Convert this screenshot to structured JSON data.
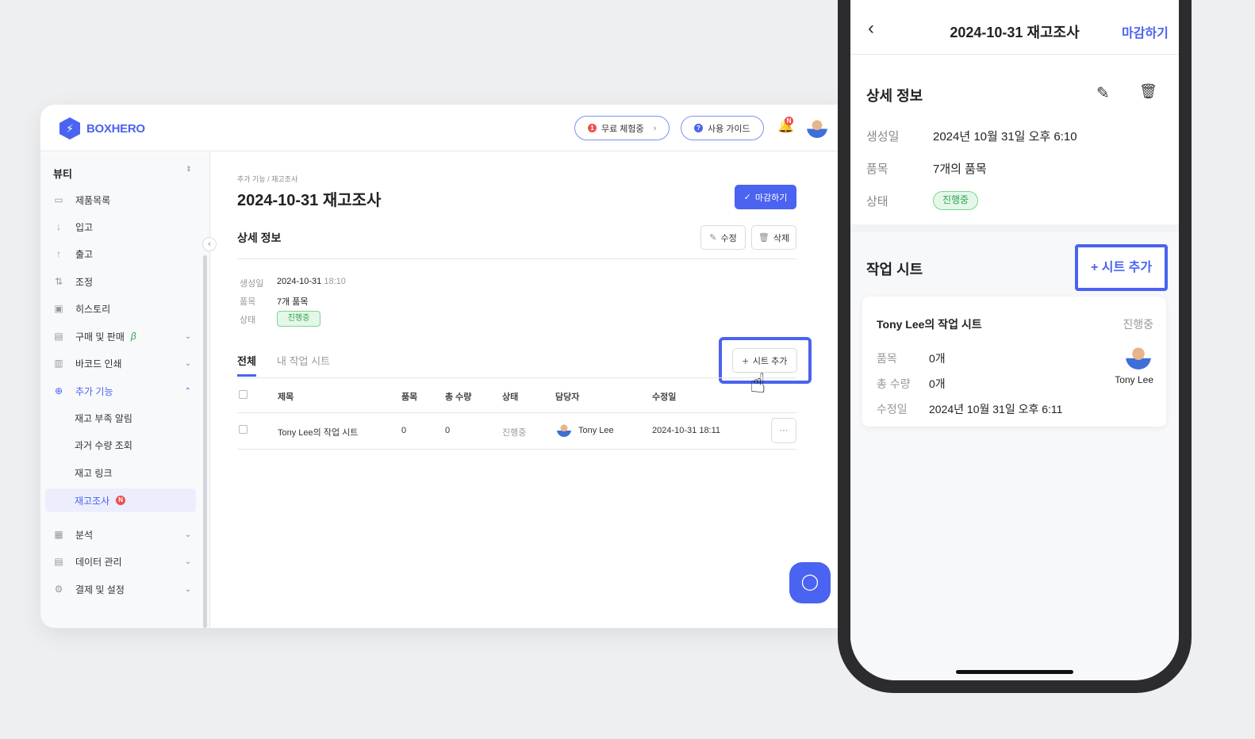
{
  "app": {
    "brand": "BOXHERO",
    "trial_label": "무료 체험중",
    "trial_count": "1",
    "guide_label": "사용 가이드",
    "notification_badge": "N",
    "accent": "#4a63f0"
  },
  "sidebar": {
    "workspace": "뷰티",
    "items": [
      {
        "label": "제품목록",
        "icon": "box-icon"
      },
      {
        "label": "입고",
        "icon": "arrow-down-icon"
      },
      {
        "label": "출고",
        "icon": "arrow-up-icon"
      },
      {
        "label": "조정",
        "icon": "swap-icon"
      },
      {
        "label": "히스토리",
        "icon": "history-icon"
      },
      {
        "label": "구매 및 판매",
        "icon": "document-icon",
        "beta": "β"
      },
      {
        "label": "바코드 인쇄",
        "icon": "barcode-icon"
      },
      {
        "label": "추가 기능",
        "icon": "plus-circle-icon"
      }
    ],
    "sub_items": [
      {
        "label": "재고 부족 알림"
      },
      {
        "label": "과거 수량 조회"
      },
      {
        "label": "재고 링크"
      },
      {
        "label": "재고조사",
        "badge": "N"
      }
    ],
    "bottom_items": [
      {
        "label": "분석"
      },
      {
        "label": "데이터 관리"
      },
      {
        "label": "결제 및 설정"
      }
    ]
  },
  "main": {
    "breadcrumb": "추가 기능 / 재고조사",
    "title": "2024-10-31 재고조사",
    "close_label": "마감하기",
    "section_title": "상세 정보",
    "edit_label": "수정",
    "delete_label": "삭제",
    "details": {
      "created_label": "생성일",
      "created_date": "2024-10-31",
      "created_time": "18:10",
      "items_label": "품목",
      "items_value": "7개 품목",
      "status_label": "상태",
      "status_value": "진행중"
    },
    "tabs": [
      "전체",
      "내 작업 시트"
    ],
    "add_sheet_label": "시트 추가",
    "table": {
      "headers": [
        "제목",
        "품목",
        "총 수량",
        "상태",
        "담당자",
        "수정일"
      ],
      "rows": [
        {
          "title": "Tony Lee의 작업 시트",
          "items": "0",
          "qty": "0",
          "status": "진행중",
          "owner": "Tony Lee",
          "modified": "2024-10-31 18:11"
        }
      ]
    }
  },
  "mobile": {
    "title": "2024-10-31 재고조사",
    "close_label": "마감하기",
    "section_title": "상세 정보",
    "details": {
      "created_label": "생성일",
      "created_value": "2024년 10월 31일 오후 6:10",
      "items_label": "품목",
      "items_value": "7개의 품목",
      "status_label": "상태",
      "status_value": "진행중"
    },
    "sheets_title": "작업 시트",
    "add_sheet_label": "+ 시트 추가",
    "card": {
      "title": "Tony Lee의 작업 시트",
      "status": "진행중",
      "items_label": "품목",
      "items_value": "0개",
      "qty_label": "총 수량",
      "qty_value": "0개",
      "modified_label": "수정일",
      "modified_value": "2024년 10월 31일 오후 6:11",
      "owner": "Tony Lee"
    }
  }
}
